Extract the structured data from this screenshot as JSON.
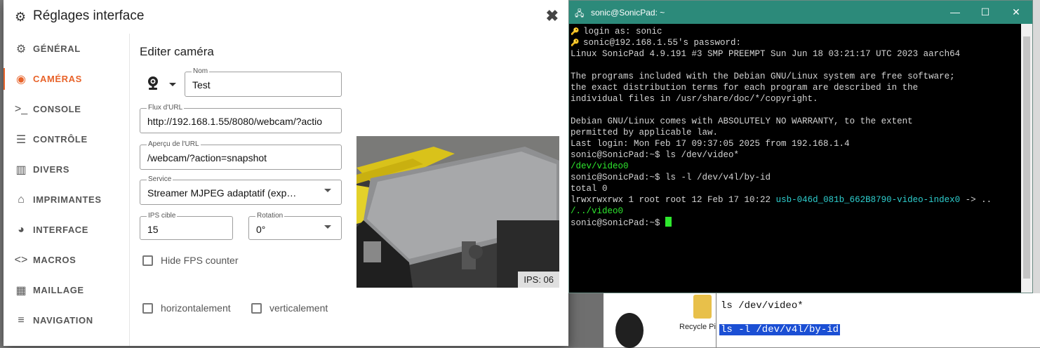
{
  "settings": {
    "title": "Réglages interface",
    "close_label": "✖",
    "sidebar": [
      {
        "label": "GÉNÉRAL",
        "icon": "gear-icon",
        "glyph": "⚙",
        "active": false
      },
      {
        "label": "CAMÉRAS",
        "icon": "webcam-icon",
        "glyph": "◉",
        "active": true
      },
      {
        "label": "CONSOLE",
        "icon": "console-icon",
        "glyph": ">_",
        "active": false
      },
      {
        "label": "CONTRÔLE",
        "icon": "tune-icon",
        "glyph": "☰",
        "active": false
      },
      {
        "label": "DIVERS",
        "icon": "widgets-icon",
        "glyph": "▥",
        "active": false
      },
      {
        "label": "IMPRIMANTES",
        "icon": "printer-3d-icon",
        "glyph": "⌂",
        "active": false
      },
      {
        "label": "INTERFACE",
        "icon": "palette-icon",
        "glyph": "◕",
        "active": false
      },
      {
        "label": "MACROS",
        "icon": "code-icon",
        "glyph": "<>",
        "active": false
      },
      {
        "label": "MAILLAGE",
        "icon": "grid-icon",
        "glyph": "▦",
        "active": false
      },
      {
        "label": "NAVIGATION",
        "icon": "menu-icon",
        "glyph": "≡",
        "active": false
      }
    ],
    "edit_title": "Editer caméra",
    "name_field": {
      "label": "Nom",
      "value": "Test"
    },
    "stream_url": {
      "label": "Flux d'URL",
      "value": "http://192.168.1.55/8080/webcam/?actio"
    },
    "snapshot_url": {
      "label": "Aperçu de l'URL",
      "value": "/webcam/?action=snapshot"
    },
    "service": {
      "label": "Service",
      "value": "Streamer MJPEG adaptatif (exp…"
    },
    "target_fps": {
      "label": "IPS cible",
      "value": "15"
    },
    "rotation": {
      "label": "Rotation",
      "value": "0°"
    },
    "hide_fps": {
      "label": "Hide FPS counter",
      "checked": false
    },
    "flip_h": {
      "label": "horizontalement",
      "checked": false
    },
    "flip_v": {
      "label": "verticalement",
      "checked": false
    },
    "preview_fps": "IPS: 06"
  },
  "terminal": {
    "title": "sonic@SonicPad: ~",
    "controls": {
      "minimize": "—",
      "maximize": "☐",
      "close": "✕"
    },
    "lines": [
      {
        "text": "login as: sonic",
        "key": true
      },
      {
        "text": "sonic@192.168.1.55's password:",
        "key": true
      },
      {
        "text": "Linux SonicPad 4.9.191 #3 SMP PREEMPT Sun Jun 18 03:21:17 UTC 2023 aarch64"
      },
      {
        "text": ""
      },
      {
        "text": "The programs included with the Debian GNU/Linux system are free software;"
      },
      {
        "text": "the exact distribution terms for each program are described in the"
      },
      {
        "text": "individual files in /usr/share/doc/*/copyright."
      },
      {
        "text": ""
      },
      {
        "text": "Debian GNU/Linux comes with ABSOLUTELY NO WARRANTY, to the extent"
      },
      {
        "text": "permitted by applicable law."
      },
      {
        "text": "Last login: Mon Feb 17 09:37:05 2025 from 192.168.1.4"
      },
      {
        "text": "sonic@SonicPad:~$ ls /dev/video*"
      },
      {
        "text": "/dev/video0",
        "color": "green"
      },
      {
        "text": "sonic@SonicPad:~$ ls -l /dev/v4l/by-id"
      },
      {
        "text": "total 0"
      },
      {
        "text": "lrwxrwxrwx 1 root root 12 Feb 17 10:22 ",
        "tail": "usb-046d_081b_662B8790-video-index0",
        "tail2": " -> .."
      },
      {
        "text": "/../video0",
        "color": "green"
      },
      {
        "text": "sonic@SonicPad:~$ ",
        "cursor": true
      }
    ]
  },
  "background": {
    "doc_line1": "ls /dev/video*",
    "doc_line2": "ls -l /dev/v4l/by-id",
    "folder_label": "Recycle Pi"
  }
}
